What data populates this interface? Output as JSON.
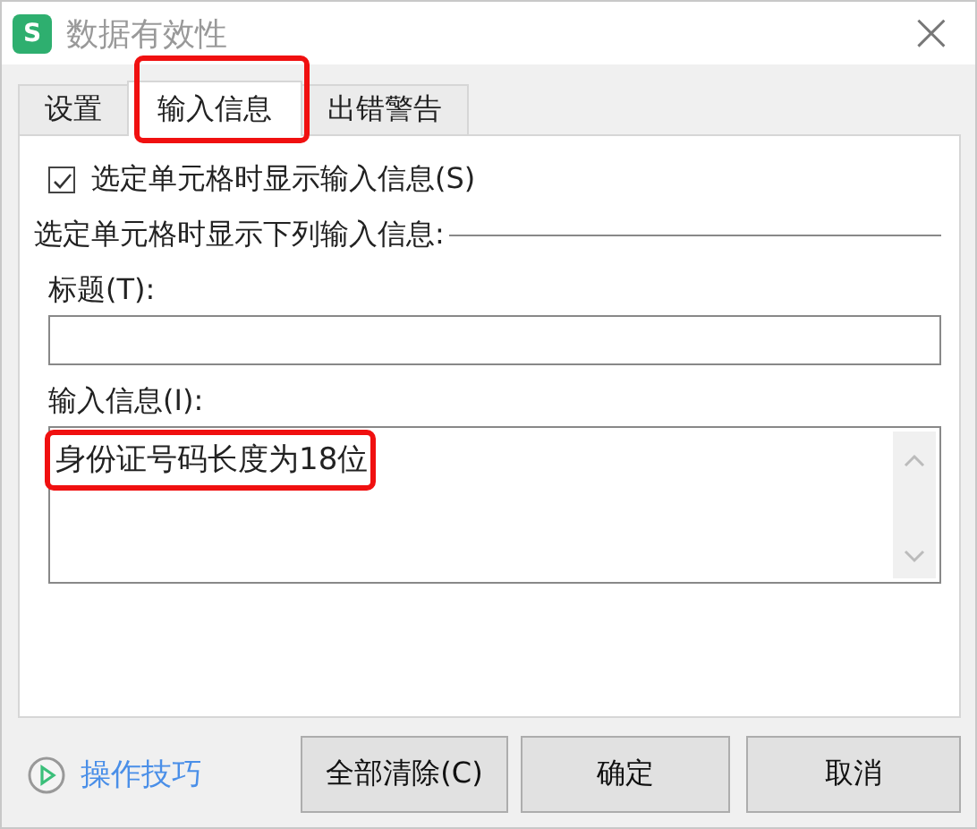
{
  "window": {
    "title": "数据有效性",
    "close": "×",
    "logo": "S"
  },
  "tabs": [
    {
      "label": "设置",
      "selected": false,
      "highlighted": false
    },
    {
      "label": "输入信息",
      "selected": true,
      "highlighted": true
    },
    {
      "label": "出错警告",
      "selected": false,
      "highlighted": false
    }
  ],
  "show_checkbox": {
    "label": "选定单元格时显示输入信息(S)",
    "checked": true
  },
  "section_label": "选定单元格时显示下列输入信息:",
  "title_field": {
    "label": "标题(T):"
  },
  "message_field": {
    "label": "输入信息(I):",
    "value": "身份证号码长度为18位",
    "highlighted": true
  },
  "tips_link": "操作技巧",
  "buttons": [
    "全部清除(C)",
    "确定",
    "取消"
  ]
}
